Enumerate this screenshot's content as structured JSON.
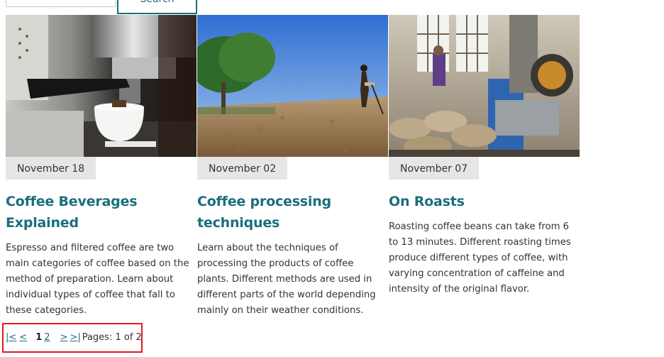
{
  "search": {
    "input_value": "",
    "button_label": "Search"
  },
  "articles": [
    {
      "image": "espresso-machine-photo",
      "date": "November 18",
      "title": "Coffee Beverages Explained",
      "text": "Espresso and filtered coffee are two main categories of coffee based on the method of preparation. Learn about individual types of coffee that fall to these categories."
    },
    {
      "image": "coffee-drying-field-photo",
      "date": "November 02",
      "title": "Coffee processing techniques",
      "text": "Learn about the techniques of processing the products of coffee plants. Different methods are used in different parts of the world depending mainly on their weather conditions."
    },
    {
      "image": "coffee-roastery-photo",
      "date": "November 07",
      "title": "On Roasts",
      "text": "Roasting coffee beans can take from 6 to 13 minutes. Different roasting times produce different types of coffee, with varying concentration of caffeine and intensity of the original flavor."
    }
  ],
  "pager": {
    "first": "|<",
    "prev": "<",
    "current_page": "1",
    "page_2": "2",
    "next": ">",
    "last": ">|",
    "summary": "Pages: 1 of 2"
  },
  "colors": {
    "accent": "#1a6e7d",
    "date_badge_bg": "#e6e6e6",
    "highlight_border": "#e01a1a"
  }
}
